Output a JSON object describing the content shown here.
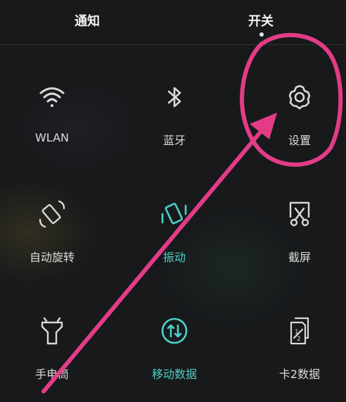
{
  "tabs": {
    "notifications": "通知",
    "switches": "开关"
  },
  "tiles": {
    "wlan": "WLAN",
    "bluetooth": "蓝牙",
    "settings": "设置",
    "auto_rotate": "自动旋转",
    "vibrate": "振动",
    "screenshot": "截屏",
    "flashlight": "手电筒",
    "mobile_data": "移动数据",
    "sim2_data": "卡2数据"
  },
  "colors": {
    "background": "#17191b",
    "active": "#4fd0c9",
    "annotation": "#e23c87"
  }
}
